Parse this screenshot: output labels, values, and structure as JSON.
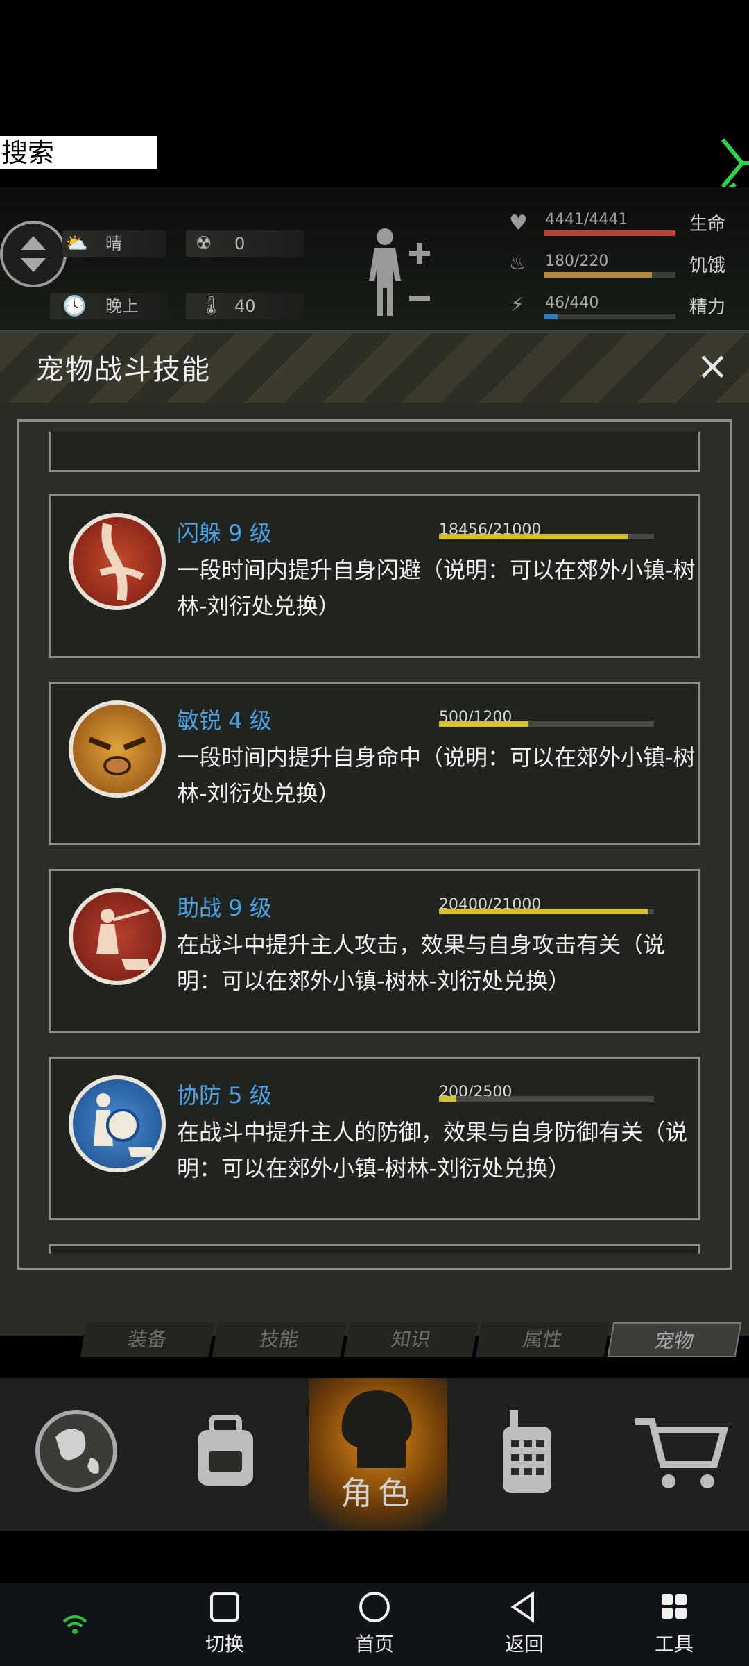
{
  "search": {
    "label": "搜索"
  },
  "weather": {
    "condition": "晴",
    "radiation": "0",
    "time_of_day": "晚上",
    "temperature": "40"
  },
  "vitals": [
    {
      "value": "4441/4441",
      "label": "生命",
      "fill": 1.0,
      "color": "#b5443a"
    },
    {
      "value": "180/220",
      "label": "饥饿",
      "fill": 0.82,
      "color": "#b5873a"
    },
    {
      "value": "46/440",
      "label": "精力",
      "fill": 0.105,
      "color": "#3a7bb5"
    }
  ],
  "panel": {
    "title": "宠物战斗技能",
    "close_icon": "×"
  },
  "skills": [
    {
      "name": "闪躲 9 级",
      "xp": "18456/21000",
      "progress": 0.879,
      "desc": "一段时间内提升自身闪避（说明：可以在郊外小镇-树林-刘衍处兑换）",
      "icon": "dodge-icon"
    },
    {
      "name": "敏锐 4 级",
      "xp": "500/1200",
      "progress": 0.417,
      "desc": "一段时间内提升自身命中（说明：可以在郊外小镇-树林-刘衍处兑换）",
      "icon": "keen-icon"
    },
    {
      "name": "助战 9 级",
      "xp": "20400/21000",
      "progress": 0.971,
      "desc": "在战斗中提升主人攻击，效果与自身攻击有关（说明：可以在郊外小镇-树林-刘衍处兑换）",
      "icon": "assist-icon"
    },
    {
      "name": "协防 5 级",
      "xp": "200/2500",
      "progress": 0.08,
      "desc": "在战斗中提升主人的防御，效果与自身防御有关（说明：可以在郊外小镇-树林-刘衍处兑换）",
      "icon": "guard-icon"
    }
  ],
  "tabs": [
    "装备",
    "技能",
    "知识",
    "属性",
    "宠物"
  ],
  "gamenav": {
    "character_label": "角色"
  },
  "sysnav": {
    "switch": "切换",
    "home": "首页",
    "back": "返回",
    "tools": "工具"
  }
}
